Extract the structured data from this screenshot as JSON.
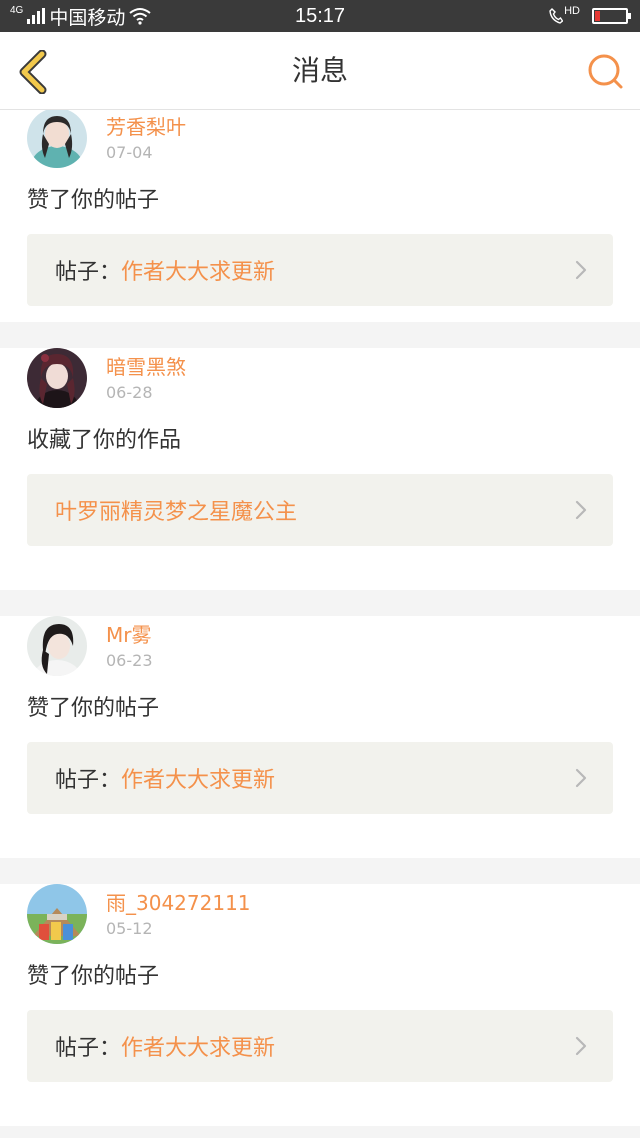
{
  "status_bar": {
    "network": "4G",
    "carrier": "中国移动",
    "time": "15:17",
    "hd_label": "HD",
    "battery_level": 0.15
  },
  "nav": {
    "title": "消息",
    "back_icon": "chevron-left-icon",
    "search_icon": "search-icon"
  },
  "colors": {
    "accent": "#f4914b",
    "back_icon": "#f2c94c",
    "target_bg": "#f2f2ed",
    "page_bg": "#f4f4f4"
  },
  "messages": [
    {
      "username": "芳香梨叶",
      "date": "07-04",
      "action": "赞了你的帖子",
      "target_prefix": "帖子：",
      "target_title": "作者大大求更新"
    },
    {
      "username": "暗雪黑煞",
      "date": "06-28",
      "action": "收藏了你的作品",
      "target_prefix": "",
      "target_title": "叶罗丽精灵梦之星魔公主"
    },
    {
      "username": "Mr雾",
      "date": "06-23",
      "action": "赞了你的帖子",
      "target_prefix": "帖子：",
      "target_title": "作者大大求更新"
    },
    {
      "username": "雨_304272111",
      "date": "05-12",
      "action": "赞了你的帖子",
      "target_prefix": "帖子：",
      "target_title": "作者大大求更新"
    }
  ]
}
